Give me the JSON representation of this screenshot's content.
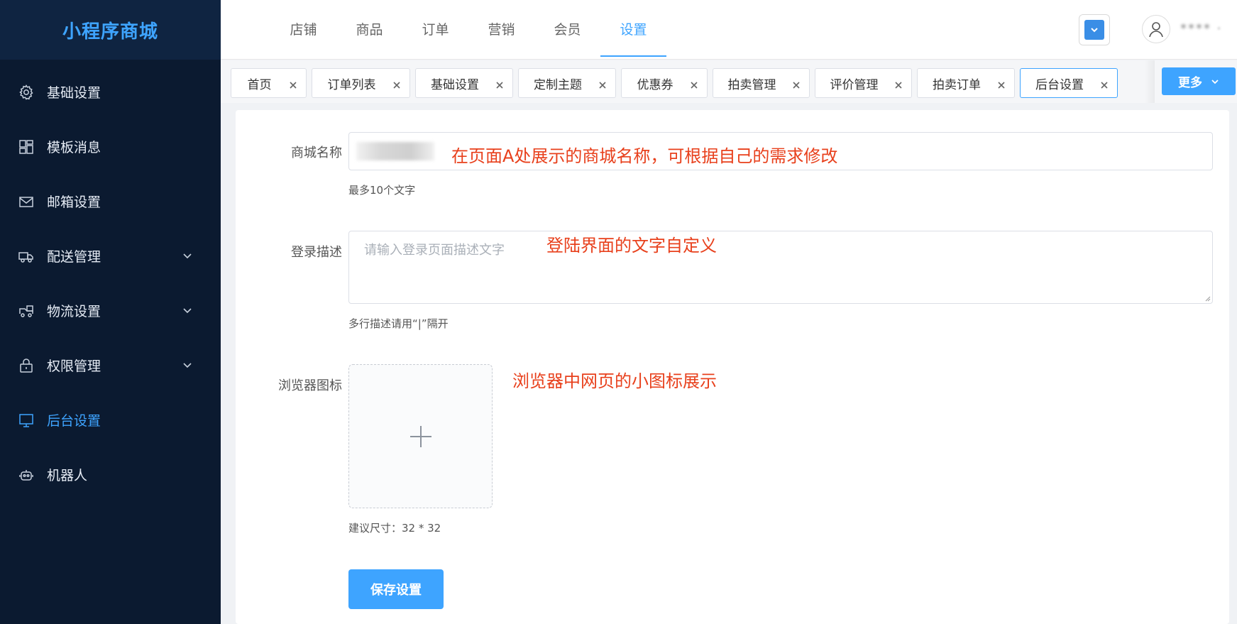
{
  "brand": {
    "title": "小程序商城"
  },
  "sidebar": {
    "items": [
      {
        "label": "基础设置",
        "icon": "gear-icon"
      },
      {
        "label": "模板消息",
        "icon": "grid-icon"
      },
      {
        "label": "邮箱设置",
        "icon": "mail-icon"
      },
      {
        "label": "配送管理",
        "icon": "truck-icon",
        "expandable": true
      },
      {
        "label": "物流设置",
        "icon": "delivery-truck-icon",
        "expandable": true
      },
      {
        "label": "权限管理",
        "icon": "lock-icon",
        "expandable": true
      },
      {
        "label": "后台设置",
        "icon": "monitor-icon",
        "active": true
      },
      {
        "label": "机器人",
        "icon": "robot-icon"
      }
    ]
  },
  "topnav": {
    "items": [
      {
        "label": "店铺"
      },
      {
        "label": "商品"
      },
      {
        "label": "订单"
      },
      {
        "label": "营销"
      },
      {
        "label": "会员"
      },
      {
        "label": "设置",
        "active": true
      }
    ],
    "username": "**** ·"
  },
  "tabs": {
    "items": [
      {
        "label": "首页"
      },
      {
        "label": "订单列表"
      },
      {
        "label": "基础设置"
      },
      {
        "label": "定制主题"
      },
      {
        "label": "优惠券"
      },
      {
        "label": "拍卖管理"
      },
      {
        "label": "评价管理"
      },
      {
        "label": "拍卖订单"
      },
      {
        "label": "后台设置",
        "active": true
      }
    ],
    "more_label": "更多"
  },
  "form": {
    "mall_name": {
      "label": "商城名称",
      "hint": "最多10个文字",
      "annotation": "在页面A处展示的商城名称，可根据自己的需求修改"
    },
    "login_desc": {
      "label": "登录描述",
      "placeholder": "请输入登录页面描述文字",
      "hint": "多行描述请用“|”隔开",
      "annotation": "登陆界面的文字自定义"
    },
    "favicon": {
      "label": "浏览器图标",
      "hint": "建议尺寸：32 * 32",
      "annotation": "浏览器中网页的小图标展示"
    },
    "save_label": "保存设置"
  },
  "colors": {
    "accent": "#3ea4ff",
    "sidebar_bg": "#0b1a30",
    "annotation": "#e8401c"
  }
}
